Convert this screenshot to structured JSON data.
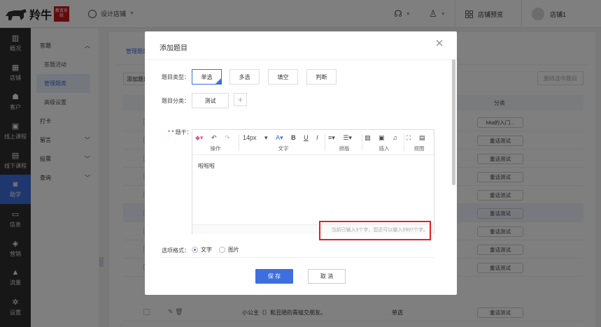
{
  "topbar": {
    "brand": "羚牛",
    "seal": "教育系统",
    "shop_switch": "设计店铺",
    "preview": "店铺预览",
    "user": "店铺1"
  },
  "rail": [
    {
      "icon": "chart-icon",
      "label": "概况"
    },
    {
      "icon": "store-icon",
      "label": "店铺"
    },
    {
      "icon": "customer-icon",
      "label": "客户"
    },
    {
      "icon": "online-course-icon",
      "label": "线上课程"
    },
    {
      "icon": "offline-course-icon",
      "label": "线下课程"
    },
    {
      "icon": "study-icon",
      "label": "助学"
    },
    {
      "icon": "message-icon",
      "label": "信息"
    },
    {
      "icon": "marketing-icon",
      "label": "营销"
    },
    {
      "icon": "traffic-icon",
      "label": "流量"
    },
    {
      "icon": "settings-icon",
      "label": "设置"
    }
  ],
  "submenu": {
    "answer_group": "答题",
    "answer_activity": "答题活动",
    "manage_bank": "管理题库",
    "advanced": "高级设置",
    "checkin": "打卡",
    "message": "留言",
    "vote": "投票",
    "query": "查询"
  },
  "background": {
    "tab": "管理题库",
    "add_label": "添加题目",
    "delete_label": "删除选中题目",
    "col_category": "分类",
    "rows": [
      {
        "tag": "Mia的入门..."
      },
      {
        "tag": "重话测试"
      },
      {
        "tag": "重话测试"
      },
      {
        "tag": "重话测试"
      },
      {
        "tag": "重话测试"
      },
      {
        "tag": "重话测试"
      },
      {
        "tag": "重话测试"
      },
      {
        "tag": "重话测试"
      },
      {
        "tag": "重话测试"
      },
      {
        "tag": "重话测试",
        "question": "小公主（）和丑陋的青蛙交朋友。",
        "qtype": "单选"
      }
    ]
  },
  "modal": {
    "title": "添加题目",
    "type_label": "题目类型：",
    "types": [
      "单选",
      "多选",
      "填空",
      "判断"
    ],
    "category_label": "题目分类：",
    "category_value": "测试",
    "stem_label": "* 题干：",
    "toolbar": {
      "font_size": "14px",
      "groups": [
        "操作",
        "文字",
        "排版",
        "插入",
        "视图"
      ]
    },
    "editor_text": "啦啦啦",
    "count_text": "当前已输入3个字，您还可以输入5997个字。",
    "option_label": "选项格式：",
    "option_text": "文字",
    "option_image": "图片",
    "save": "保 存",
    "cancel": "取 消"
  },
  "colors": {
    "accent": "#3d6fde",
    "highlight_border": "#e02020",
    "rail_bg": "#2e2e2e"
  }
}
